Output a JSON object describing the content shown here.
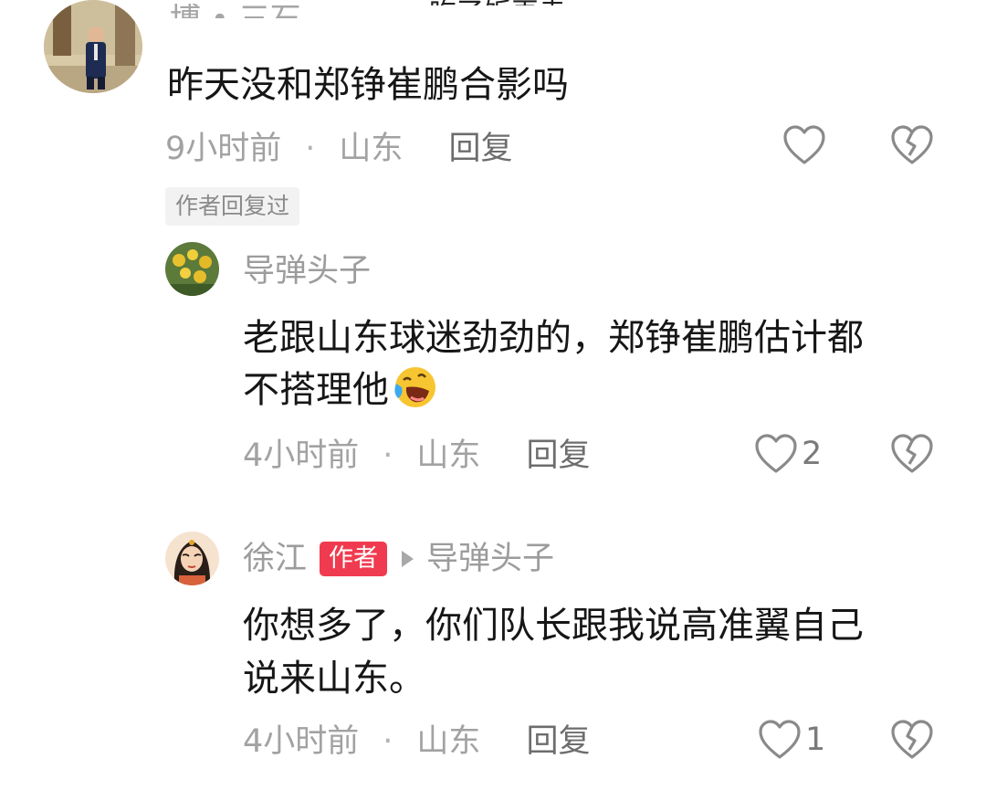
{
  "header": {
    "partial_text": "吃了饭再走"
  },
  "comment_top": {
    "username_partial": "博 • 三石",
    "text": "昨天没和郑铮崔鹏合影吗",
    "time": "9小时前",
    "location": "山东",
    "reply_label": "回复",
    "like_count": "",
    "author_replied_tag": "作者回复过"
  },
  "reply_1": {
    "username": "导弹头子",
    "text_line1": "老跟山东球迷劲劲的，郑铮崔鹏估计都",
    "text_line2": "不搭理他",
    "time": "4小时前",
    "location": "山东",
    "reply_label": "回复",
    "like_count": "2"
  },
  "reply_2": {
    "username": "徐江",
    "author_badge": "作者",
    "reply_to": "导弹头子",
    "text_line1": "你想多了，你们队长跟我说高准翼自己",
    "text_line2": "说来山东。",
    "time": "4小时前",
    "location": "山东",
    "reply_label": "回复",
    "like_count": "1"
  },
  "meta_separator": "·",
  "colors": {
    "author_badge_bg": "#f03a4f",
    "text": "#161616",
    "muted": "#a2a2a2",
    "icon": "#8a8a8a"
  },
  "icons": [
    "heart-icon",
    "broken-heart-icon",
    "laughing-tears-emoji"
  ]
}
